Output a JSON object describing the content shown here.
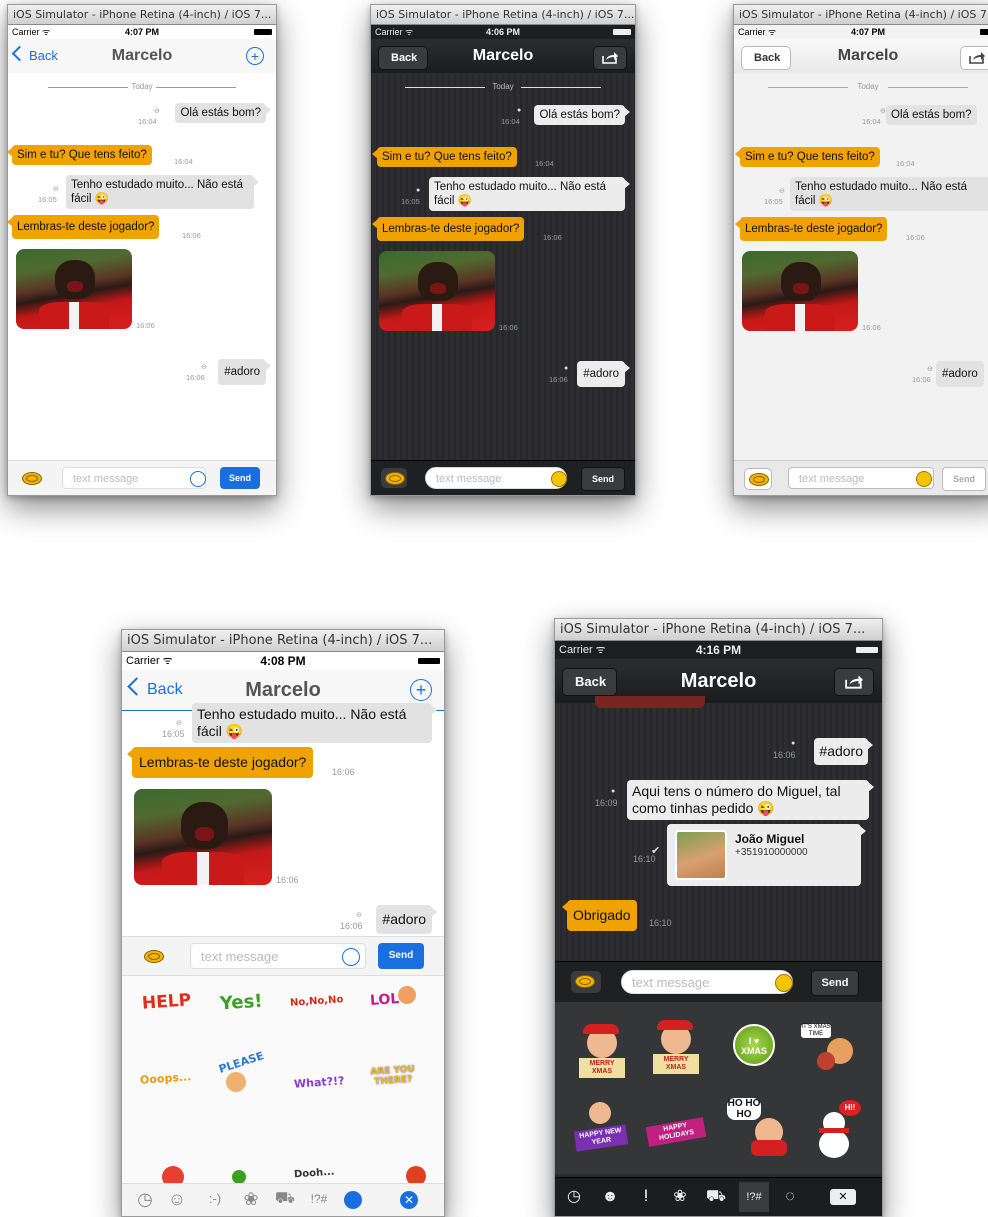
{
  "window_title": "iOS Simulator - iPhone Retina (4-inch) / iOS 7...",
  "carrier": "Carrier",
  "times": {
    "a": "4:07 PM",
    "b": "4:06 PM",
    "c": "4:07 PM",
    "d": "4:08 PM",
    "e": "4:16 PM"
  },
  "nav": {
    "back": "Back",
    "title": "Marcelo"
  },
  "day_label": "Today",
  "messages": {
    "m1": "Olá estás bom?",
    "m2": "Sim e tu? Que tens feito?",
    "m3a": "Tenho estudado muito... Não está",
    "m3b": "fácil",
    "m4": "Lembras-te deste jogador?",
    "m5": "#adoro",
    "m6a": "Aqui tens o número do Miguel, tal",
    "m6b": "como tinhas pedido",
    "m7": "Obrigado"
  },
  "timestamps": {
    "t1": "16:04",
    "t2": "16:04",
    "t3": "16:05",
    "t4": "16:06",
    "t5": "16:06",
    "t6": "16:06",
    "t7": "16:09",
    "t8": "16:10",
    "t9": "16:10"
  },
  "contact": {
    "name": "João Miguel",
    "phone": "+351910000000"
  },
  "input": {
    "placeholder": "text message",
    "send": "Send"
  },
  "stickers_light": [
    "HELP",
    "Yes!",
    "No,No,No",
    "LOL",
    "Ooops...",
    "PLEASE",
    "What?!?",
    "ARE YOU THERE?",
    "Dooh..."
  ],
  "stickers_dark": [
    "MERRY XMAS",
    "MERRY XMAS",
    "I ♥ XMAS",
    "IT'S XMAS TIME",
    "HAPPY NEW YEAR",
    "HAPPY HOLIDAYS",
    "HO HO HO",
    "HI!"
  ],
  "tabs_light": [
    "clock-icon",
    "smiley-icon",
    ":-)",
    "flower-icon",
    "car-icon",
    "!?#",
    "sticker-icon",
    "delete-icon"
  ],
  "tab_labels": {
    "emoticon": ":-)",
    "symbols": "!?#"
  },
  "colors": {
    "accent": "#1a6fe0",
    "bubble_in": "#efa200",
    "bubble_out": "#e2e2e2",
    "dark_bg": "#2a2b2d"
  }
}
